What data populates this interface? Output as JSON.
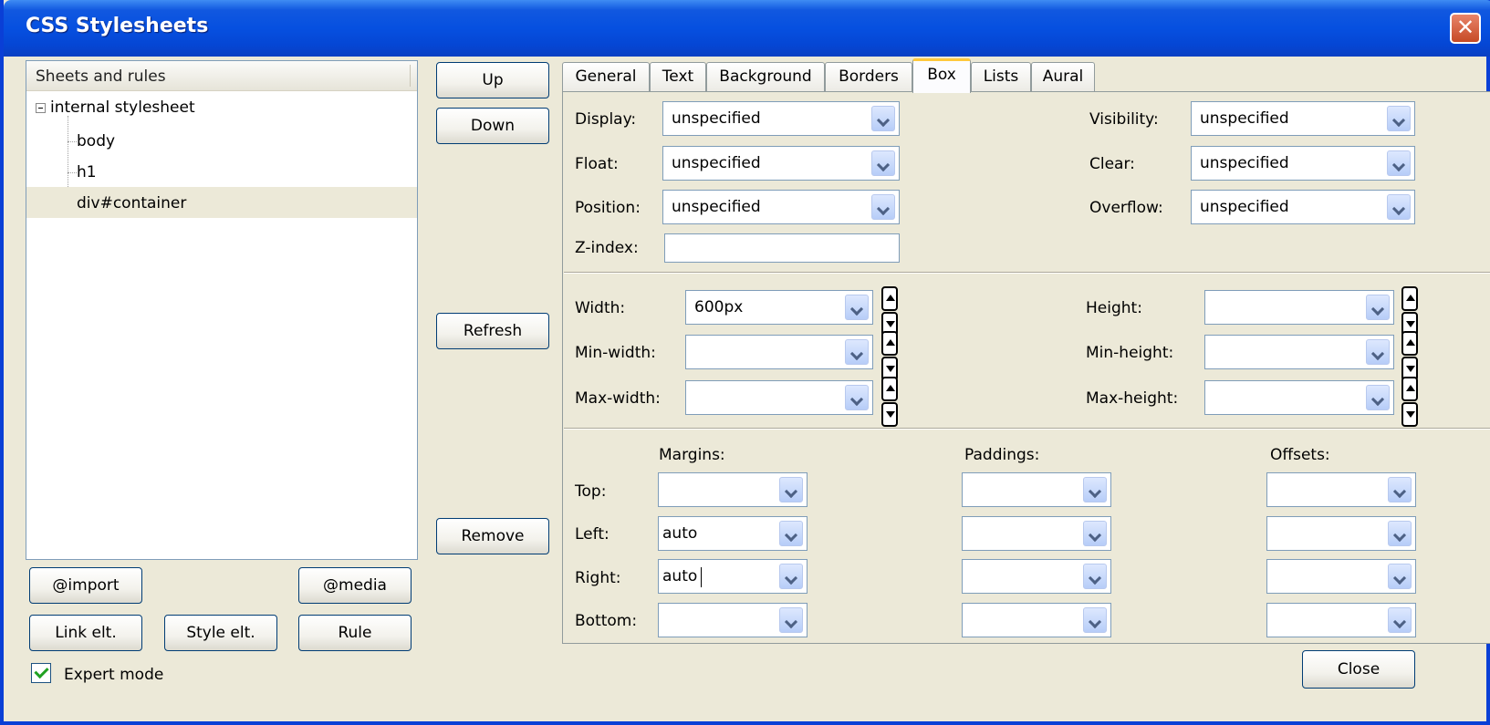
{
  "window": {
    "title": "CSS Stylesheets"
  },
  "left_panel": {
    "header": "Sheets and rules",
    "tree": {
      "root": "internal stylesheet",
      "children": [
        "body",
        "h1",
        "div#container"
      ],
      "selected": "div#container"
    },
    "buttons": {
      "import": "@import",
      "media": "@media",
      "link": "Link elt.",
      "style": "Style elt.",
      "rule": "Rule"
    },
    "expert_mode": {
      "label": "Expert mode",
      "checked": true
    }
  },
  "middle_buttons": {
    "up": "Up",
    "down": "Down",
    "refresh": "Refresh",
    "remove": "Remove"
  },
  "tabs": [
    "General",
    "Text",
    "Background",
    "Borders",
    "Box",
    "Lists",
    "Aural"
  ],
  "active_tab": "Box",
  "box": {
    "display": {
      "label": "Display:",
      "value": "unspecified"
    },
    "float": {
      "label": "Float:",
      "value": "unspecified"
    },
    "position": {
      "label": "Position:",
      "value": "unspecified"
    },
    "zindex": {
      "label": "Z-index:",
      "value": ""
    },
    "visibility": {
      "label": "Visibility:",
      "value": "unspecified"
    },
    "clear": {
      "label": "Clear:",
      "value": "unspecified"
    },
    "overflow": {
      "label": "Overflow:",
      "value": "unspecified"
    },
    "width": {
      "label": "Width:",
      "value": "600px"
    },
    "min_width": {
      "label": "Min-width:",
      "value": ""
    },
    "max_width": {
      "label": "Max-width:",
      "value": ""
    },
    "height": {
      "label": "Height:",
      "value": ""
    },
    "min_height": {
      "label": "Min-height:",
      "value": ""
    },
    "max_height": {
      "label": "Max-height:",
      "value": ""
    },
    "columns": {
      "margins": "Margins:",
      "paddings": "Paddings:",
      "offsets": "Offsets:"
    },
    "rows": {
      "top": "Top:",
      "left": "Left:",
      "right": "Right:",
      "bottom": "Bottom:"
    },
    "margins": {
      "top": "",
      "left": "auto",
      "right": "auto",
      "bottom": ""
    },
    "paddings": {
      "top": "",
      "left": "",
      "right": "",
      "bottom": ""
    },
    "offsets": {
      "top": "",
      "left": "",
      "right": "",
      "bottom": ""
    }
  },
  "close_button": "Close",
  "colors": {
    "titlebar": "#0650e0",
    "face": "#ece9d8",
    "tab_highlight": "#ffc83c",
    "checkbox_check": "#21a121"
  }
}
